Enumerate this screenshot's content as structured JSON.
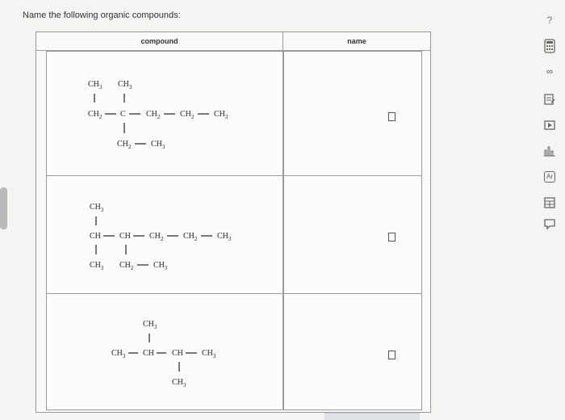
{
  "prompt": "Name the following organic compounds:",
  "help_label": "?",
  "table": {
    "col_compound": "compound",
    "col_name": "name"
  },
  "molecules": [
    {
      "top_labels": [
        "CH3",
        "CH3"
      ],
      "main_chain": [
        "CH2",
        "C",
        "CH2",
        "CH2",
        "CH3"
      ],
      "bottom_labels": [
        "CH2",
        "CH3"
      ],
      "answer": ""
    },
    {
      "top_labels": [
        "CH3"
      ],
      "main_chain": [
        "CH",
        "CH",
        "CH2",
        "CH2",
        "CH3"
      ],
      "bottom_labels": [
        "CH3",
        "CH2",
        "CH3"
      ],
      "answer": ""
    },
    {
      "top_labels": [
        "CH3"
      ],
      "main_chain": [
        "CH3",
        "CH",
        "CH",
        "CH3"
      ],
      "bottom_labels": [
        "CH3"
      ],
      "answer": ""
    }
  ],
  "sidebar_icons": [
    "calculator-icon",
    "infinity-icon",
    "notes-icon",
    "video-icon",
    "chart-icon",
    "periodic-table-icon",
    "grid-calc-icon",
    "message-icon"
  ]
}
